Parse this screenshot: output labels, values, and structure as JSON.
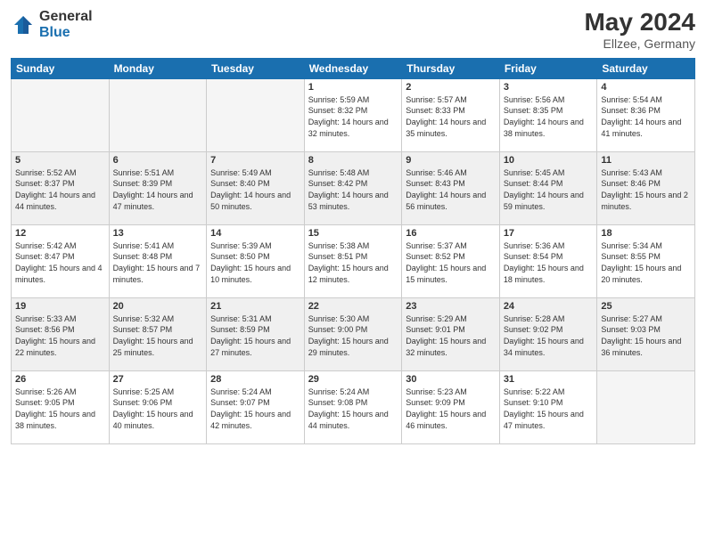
{
  "header": {
    "logo_general": "General",
    "logo_blue": "Blue",
    "month_title": "May 2024",
    "location": "Ellzee, Germany"
  },
  "days_of_week": [
    "Sunday",
    "Monday",
    "Tuesday",
    "Wednesday",
    "Thursday",
    "Friday",
    "Saturday"
  ],
  "weeks": [
    [
      {
        "day": "",
        "text": "",
        "empty": true
      },
      {
        "day": "",
        "text": "",
        "empty": true
      },
      {
        "day": "",
        "text": "",
        "empty": true
      },
      {
        "day": "1",
        "text": "Sunrise: 5:59 AM\nSunset: 8:32 PM\nDaylight: 14 hours\nand 32 minutes."
      },
      {
        "day": "2",
        "text": "Sunrise: 5:57 AM\nSunset: 8:33 PM\nDaylight: 14 hours\nand 35 minutes."
      },
      {
        "day": "3",
        "text": "Sunrise: 5:56 AM\nSunset: 8:35 PM\nDaylight: 14 hours\nand 38 minutes."
      },
      {
        "day": "4",
        "text": "Sunrise: 5:54 AM\nSunset: 8:36 PM\nDaylight: 14 hours\nand 41 minutes."
      }
    ],
    [
      {
        "day": "5",
        "text": "Sunrise: 5:52 AM\nSunset: 8:37 PM\nDaylight: 14 hours\nand 44 minutes.",
        "shaded": true
      },
      {
        "day": "6",
        "text": "Sunrise: 5:51 AM\nSunset: 8:39 PM\nDaylight: 14 hours\nand 47 minutes.",
        "shaded": true
      },
      {
        "day": "7",
        "text": "Sunrise: 5:49 AM\nSunset: 8:40 PM\nDaylight: 14 hours\nand 50 minutes.",
        "shaded": true
      },
      {
        "day": "8",
        "text": "Sunrise: 5:48 AM\nSunset: 8:42 PM\nDaylight: 14 hours\nand 53 minutes.",
        "shaded": true
      },
      {
        "day": "9",
        "text": "Sunrise: 5:46 AM\nSunset: 8:43 PM\nDaylight: 14 hours\nand 56 minutes.",
        "shaded": true
      },
      {
        "day": "10",
        "text": "Sunrise: 5:45 AM\nSunset: 8:44 PM\nDaylight: 14 hours\nand 59 minutes.",
        "shaded": true
      },
      {
        "day": "11",
        "text": "Sunrise: 5:43 AM\nSunset: 8:46 PM\nDaylight: 15 hours\nand 2 minutes.",
        "shaded": true
      }
    ],
    [
      {
        "day": "12",
        "text": "Sunrise: 5:42 AM\nSunset: 8:47 PM\nDaylight: 15 hours\nand 4 minutes."
      },
      {
        "day": "13",
        "text": "Sunrise: 5:41 AM\nSunset: 8:48 PM\nDaylight: 15 hours\nand 7 minutes."
      },
      {
        "day": "14",
        "text": "Sunrise: 5:39 AM\nSunset: 8:50 PM\nDaylight: 15 hours\nand 10 minutes."
      },
      {
        "day": "15",
        "text": "Sunrise: 5:38 AM\nSunset: 8:51 PM\nDaylight: 15 hours\nand 12 minutes."
      },
      {
        "day": "16",
        "text": "Sunrise: 5:37 AM\nSunset: 8:52 PM\nDaylight: 15 hours\nand 15 minutes."
      },
      {
        "day": "17",
        "text": "Sunrise: 5:36 AM\nSunset: 8:54 PM\nDaylight: 15 hours\nand 18 minutes."
      },
      {
        "day": "18",
        "text": "Sunrise: 5:34 AM\nSunset: 8:55 PM\nDaylight: 15 hours\nand 20 minutes."
      }
    ],
    [
      {
        "day": "19",
        "text": "Sunrise: 5:33 AM\nSunset: 8:56 PM\nDaylight: 15 hours\nand 22 minutes.",
        "shaded": true
      },
      {
        "day": "20",
        "text": "Sunrise: 5:32 AM\nSunset: 8:57 PM\nDaylight: 15 hours\nand 25 minutes.",
        "shaded": true
      },
      {
        "day": "21",
        "text": "Sunrise: 5:31 AM\nSunset: 8:59 PM\nDaylight: 15 hours\nand 27 minutes.",
        "shaded": true
      },
      {
        "day": "22",
        "text": "Sunrise: 5:30 AM\nSunset: 9:00 PM\nDaylight: 15 hours\nand 29 minutes.",
        "shaded": true
      },
      {
        "day": "23",
        "text": "Sunrise: 5:29 AM\nSunset: 9:01 PM\nDaylight: 15 hours\nand 32 minutes.",
        "shaded": true
      },
      {
        "day": "24",
        "text": "Sunrise: 5:28 AM\nSunset: 9:02 PM\nDaylight: 15 hours\nand 34 minutes.",
        "shaded": true
      },
      {
        "day": "25",
        "text": "Sunrise: 5:27 AM\nSunset: 9:03 PM\nDaylight: 15 hours\nand 36 minutes.",
        "shaded": true
      }
    ],
    [
      {
        "day": "26",
        "text": "Sunrise: 5:26 AM\nSunset: 9:05 PM\nDaylight: 15 hours\nand 38 minutes."
      },
      {
        "day": "27",
        "text": "Sunrise: 5:25 AM\nSunset: 9:06 PM\nDaylight: 15 hours\nand 40 minutes."
      },
      {
        "day": "28",
        "text": "Sunrise: 5:24 AM\nSunset: 9:07 PM\nDaylight: 15 hours\nand 42 minutes."
      },
      {
        "day": "29",
        "text": "Sunrise: 5:24 AM\nSunset: 9:08 PM\nDaylight: 15 hours\nand 44 minutes."
      },
      {
        "day": "30",
        "text": "Sunrise: 5:23 AM\nSunset: 9:09 PM\nDaylight: 15 hours\nand 46 minutes."
      },
      {
        "day": "31",
        "text": "Sunrise: 5:22 AM\nSunset: 9:10 PM\nDaylight: 15 hours\nand 47 minutes."
      },
      {
        "day": "",
        "text": "",
        "empty": true
      }
    ]
  ]
}
